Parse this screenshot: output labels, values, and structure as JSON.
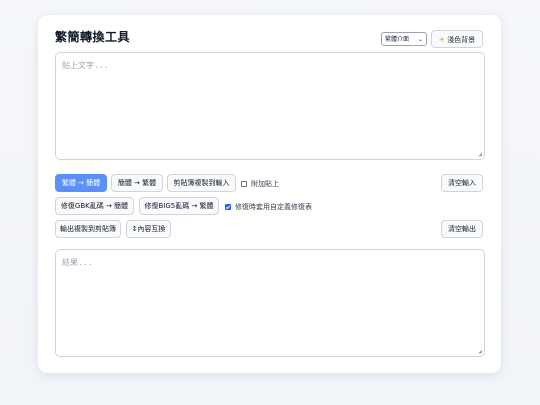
{
  "app": {
    "title": "繁簡轉換工具"
  },
  "header": {
    "ui_select": "繁體介面",
    "theme_button": "淺色背景"
  },
  "input": {
    "placeholder": "貼上文字..."
  },
  "actions": {
    "t2s": "繁體 → 簡體",
    "s2t": "簡體 → 繁體",
    "paste_input": "剪貼簿複製到輸入",
    "append_paste": "附加貼上",
    "append_paste_checked": false,
    "clear_input": "清空輸入",
    "fix_gbk": "修復GBK亂碼 → 簡體",
    "fix_big5": "修復BIG5亂碼 → 繁體",
    "custom_dict": "修復時套用自定義修復表",
    "custom_dict_checked": true,
    "copy_output": "輸出複製到剪貼簿",
    "swap": "↕內容互換",
    "clear_output": "清空輸出"
  },
  "output": {
    "placeholder": "結果..."
  },
  "colors": {
    "primary": "#5b8ff9",
    "checkbox_on": "#2563eb"
  }
}
